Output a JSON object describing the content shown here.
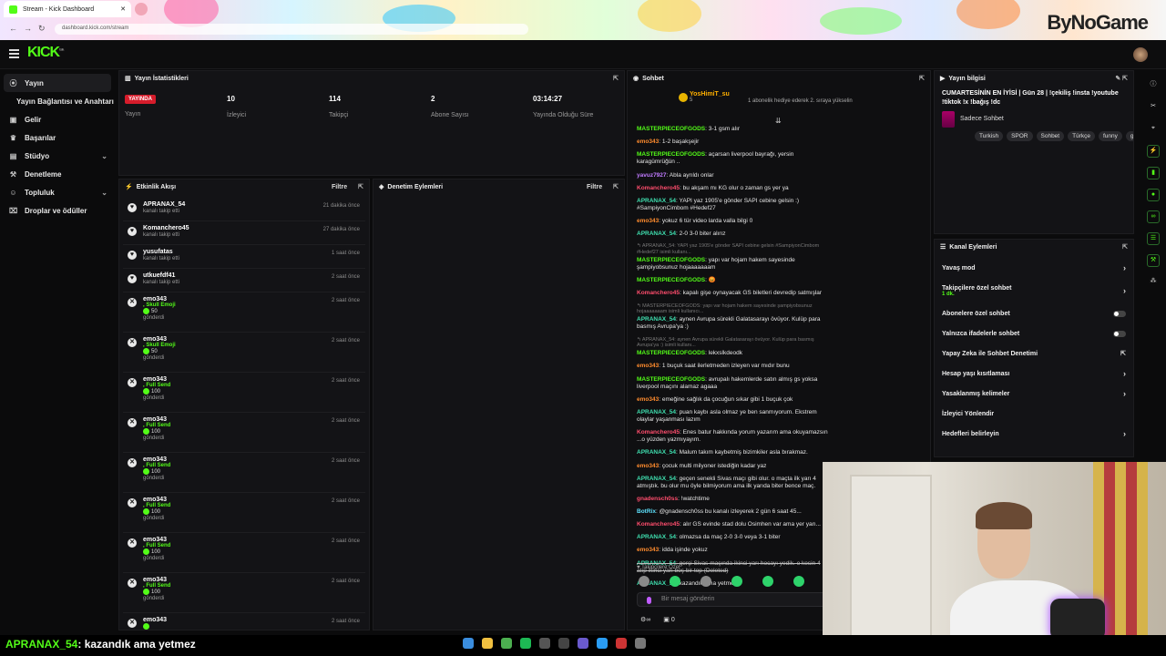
{
  "browser": {
    "tab_title": "Stream - Kick Dashboard",
    "url": "dashboard.kick.com/stream",
    "brand_overlay": "ByNoGame"
  },
  "topnav": {
    "logo": "KICK",
    "logo_superscript": "beta"
  },
  "sidebar": {
    "items": [
      {
        "label": "Yayın",
        "icon": "broadcast-icon",
        "active": true
      },
      {
        "label": "Yayın Bağlantısı ve Anahtarı",
        "icon": "",
        "active": false
      },
      {
        "label": "Gelir",
        "icon": "wallet-icon",
        "active": false
      },
      {
        "label": "Başarılar",
        "icon": "trophy-icon",
        "active": false
      },
      {
        "label": "Stüdyo",
        "icon": "studio-icon",
        "active": false,
        "chevron": true
      },
      {
        "label": "Denetleme",
        "icon": "hammer-icon",
        "active": false
      },
      {
        "label": "Topluluk",
        "icon": "people-icon",
        "active": false,
        "chevron": true
      },
      {
        "label": "Droplar ve ödüller",
        "icon": "gift-icon",
        "active": false
      }
    ]
  },
  "stats": {
    "title": "Yayın İstatistikleri",
    "live_badge": "YAYINDA",
    "items": [
      {
        "value": "",
        "label": "Yayın"
      },
      {
        "value": "10",
        "label": "İzleyici"
      },
      {
        "value": "114",
        "label": "Takipçi"
      },
      {
        "value": "2",
        "label": "Abone Sayısı"
      },
      {
        "value": "03:14:27",
        "label": "Yayında Olduğu Süre"
      }
    ]
  },
  "activity": {
    "title": "Etkinlik Akışı",
    "filter": "Filtre",
    "items": [
      {
        "name": "APRANAX_54",
        "desc": "kanalı takip etti",
        "time": "21 dakika önce",
        "type": "follow"
      },
      {
        "name": "Komanchero45",
        "desc": "kanalı takip etti",
        "time": "27 dakika önce",
        "type": "follow"
      },
      {
        "name": "yusufatas",
        "desc": "kanalı takip etti",
        "time": "1 saat önce",
        "type": "follow"
      },
      {
        "name": "utkuefdf41",
        "desc": "kanalı takip etti",
        "time": "2 saat önce",
        "type": "follow"
      },
      {
        "name": "emo343",
        "gift": ", Skull Emoji",
        "amount": "50",
        "desc": "gönderdi",
        "time": "2 saat önce",
        "type": "gift"
      },
      {
        "name": "emo343",
        "gift": ", Skull Emoji",
        "amount": "50",
        "desc": "gönderdi",
        "time": "2 saat önce",
        "type": "gift"
      },
      {
        "name": "emo343",
        "gift": ", Full Send",
        "amount": "100",
        "desc": "gönderdi",
        "time": "2 saat önce",
        "type": "gift"
      },
      {
        "name": "emo343",
        "gift": ", Full Send",
        "amount": "100",
        "desc": "gönderdi",
        "time": "2 saat önce",
        "type": "gift"
      },
      {
        "name": "emo343",
        "gift": ", Full Send",
        "amount": "100",
        "desc": "gönderdi",
        "time": "2 saat önce",
        "type": "gift"
      },
      {
        "name": "emo343",
        "gift": ", Full Send",
        "amount": "100",
        "desc": "gönderdi",
        "time": "2 saat önce",
        "type": "gift"
      },
      {
        "name": "emo343",
        "gift": ", Full Send",
        "amount": "100",
        "desc": "gönderdi",
        "time": "2 saat önce",
        "type": "gift"
      },
      {
        "name": "emo343",
        "gift": ", Full Send",
        "amount": "100",
        "desc": "gönderdi",
        "time": "2 saat önce",
        "type": "gift"
      },
      {
        "name": "emo343",
        "gift": "",
        "amount": "",
        "desc": "",
        "time": "2 saat önce",
        "type": "gift"
      }
    ]
  },
  "moderation": {
    "title": "Denetim Eylemleri",
    "filter": "Filtre"
  },
  "chat": {
    "title": "Sohbet",
    "pinned_user": "YosHimiT_su",
    "pinned_count": "5",
    "pinned_text": "1 abonelik hediye ederek 2. sıraya yükselin",
    "messages": [
      {
        "user": "MASTERPIECEOFGODS",
        "color": "green",
        "text": "3-1 gsm alır"
      },
      {
        "user": "emo343",
        "color": "orange",
        "text": "1-2 başakşejir"
      },
      {
        "user": "MASTERPIECEOFGODS",
        "color": "green",
        "text": "açarsan liverpool bayrağı, yersin karagümrüğün .."
      },
      {
        "user": "yavuz7927",
        "color": "purple",
        "text": "Abla ayrıldı onlar"
      },
      {
        "user": "Komanchero45",
        "color": "red",
        "text": "bu akşam mı KG olur o zaman gs yer ya"
      },
      {
        "user": "APRANAX_54",
        "color": "teal",
        "text": "YAPI yaz 1905'e gönder SAPI cebine gelsin :) #SampiyonCimbom #Hedef27"
      },
      {
        "user": "emo343",
        "color": "orange",
        "text": "yokuz 6 tür video larda valla bilgi 0"
      },
      {
        "user": "APRANAX_54",
        "color": "teal",
        "text": "2-0 3-0 biter alırız"
      },
      {
        "reply": "APRANAX_54: YAPI yaz 1905'e gönder SAPI cebine gelsin #SampiyonCimbom #Hedef27 isimli kullanı..."
      },
      {
        "user": "MASTERPIECEOFGODS",
        "color": "green",
        "text": "yapı var hojam hakem sayesinde şampiyobsunuz hojaaaaaaam"
      },
      {
        "user": "MASTERPIECEOFGODS",
        "color": "green",
        "text": "😡"
      },
      {
        "user": "Komanchero45",
        "color": "red",
        "text": "kapalı gişe oynayacak GS biletleri devredip satmışlar"
      },
      {
        "reply": "MASTERPIECEOFGODS: yapı var hojam hakem sayesinde şampiyobsunuz hojaaaaaaam isimli kullanıcı..."
      },
      {
        "user": "APRANAX_54",
        "color": "teal",
        "text": "aynen Avrupa sürekli Galatasarayı övüyor. Kulüp para basmış Avrupa'ya :)"
      },
      {
        "reply": "APRANAX_54: aynen Avrupa sürekli Galatasarayı övüyor. Kulüp para basmış Avrupa'ya :) isimli kullanı..."
      },
      {
        "user": "MASTERPIECEOFGODS",
        "color": "green",
        "text": "lekxslkdeodk"
      },
      {
        "user": "emo343",
        "color": "orange",
        "text": "1 buçuk saat ilerletmeden izleyen var mıdır bunu"
      },
      {
        "user": "MASTERPIECEOFGODS",
        "color": "green",
        "text": "avrupalı hakemlerde satın almış gs yoksa liverpool maçını alamaz agaaa"
      },
      {
        "user": "emo343",
        "color": "orange",
        "text": "emeğine sağlık da çocuğun sıkar gibi 1 buçuk çok"
      },
      {
        "user": "APRANAX_54",
        "color": "teal",
        "text": "puan kaybı asla olmaz ye ben sanmıyorum. Ekstrem olaylar yaşanması lazım"
      },
      {
        "user": "Komanchero45",
        "color": "red",
        "text": "Enes batur hakkında yorum yazarım ama okuyamazsın ...o yüzden yazmıyayım."
      },
      {
        "user": "APRANAX_54",
        "color": "teal",
        "text": "Malum takım kaybetmiş bizimkiler asla bırakmaz."
      },
      {
        "user": "emo343",
        "color": "orange",
        "text": "çocuk multi milyoner istediğin kadar yaz"
      },
      {
        "user": "APRANAX_54",
        "color": "teal",
        "text": "geçen senekli Sivas maçı gibi olur. o maçta ilk yarı 4 atmıştık. bu olur mu öyle bilmiyorum ama ilk yarıda biter bence maç."
      },
      {
        "user": "gnadensch0ss",
        "color": "red",
        "text": "!watchtime"
      },
      {
        "user": "BotRix",
        "color": "blue",
        "text": "@gnadensch0ss bu kanalı izleyerek 2 gün 6 saat 45..."
      },
      {
        "user": "Komanchero45",
        "color": "red",
        "text": "alır GS evinde stad dolu Osimhen var ama yer yarı..."
      },
      {
        "user": "APRANAX_54",
        "color": "teal",
        "text": "olmazsa da maç 2-0 3-0 veya 3-1 biter"
      },
      {
        "user": "emo343",
        "color": "orange",
        "text": "idda işinde yokuz"
      },
      {
        "user": "APRANAX_54",
        "color": "teal",
        "text": "gerçi Sivas maçında ikinci yarı hocayı yedik. o kesin 4 atıp ikinci yarı boş bir top (Deleted)",
        "deleted": true
      },
      {
        "user": "APRANAX_54",
        "color": "teal",
        "text": "kazandık ama yetmez"
      }
    ],
    "followers_only": "Takipçilere Özel",
    "input_placeholder": "Bir mesaj gönderin",
    "footer_count": "0"
  },
  "stream_info": {
    "title_label": "Yayın bilgisi",
    "title": "CUMARTESİNİN EN İYİSİ | Gün 28 | !çekiliş !insta !youtube !tiktok !x !bağış !dc",
    "category": "Sadece Sohbet",
    "tags": [
      "Turkish",
      "SPOR",
      "Sohbet",
      "Türkçe",
      "funny",
      "gan"
    ]
  },
  "channel_actions": {
    "title": "Kanal Eylemleri",
    "items": [
      {
        "label": "Yavaş mod",
        "ctrl": "arrow"
      },
      {
        "label": "Takipçilere özel sohbet",
        "sub": "1 dk.",
        "ctrl": "arrow"
      },
      {
        "label": "Abonelere özel sohbet",
        "ctrl": "switch"
      },
      {
        "label": "Yalnızca ifadelerle sohbet",
        "ctrl": "switch"
      },
      {
        "label": "Yapay Zeka ile Sohbet Denetimi",
        "ctrl": "link"
      },
      {
        "label": "Hesap yaşı kısıtlaması",
        "ctrl": "arrow"
      },
      {
        "label": "Yasaklanmış kelimeler",
        "ctrl": "arrow"
      },
      {
        "label": "İzleyici Yönlendir",
        "ctrl": ""
      },
      {
        "label": "Hedefleri belirleyin",
        "ctrl": "arrow"
      }
    ]
  },
  "ticker": {
    "user": "APRANAX_54",
    "text": ": kazandık ama yetmez"
  }
}
